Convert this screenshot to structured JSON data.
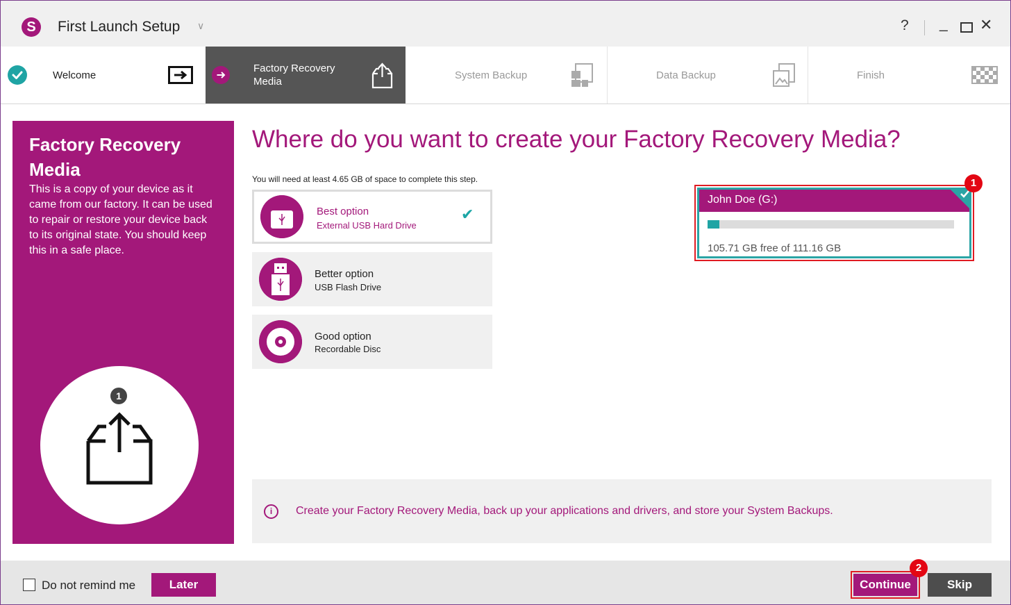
{
  "window": {
    "logo_letter": "S",
    "title": "First Launch Setup",
    "help_label": "?",
    "minimize_label": "_",
    "close_label": "✕"
  },
  "steps": [
    {
      "label": "Welcome",
      "state": "done",
      "icon": "arrow-box-icon"
    },
    {
      "label_line1": "Factory Recovery",
      "label_line2": "Media",
      "state": "active",
      "icon": "box-upload-icon"
    },
    {
      "label": "System Backup",
      "state": "pending",
      "icon": "windows-backup-icon"
    },
    {
      "label": "Data Backup",
      "state": "pending",
      "icon": "image-backup-icon"
    },
    {
      "label": "Finish",
      "state": "pending",
      "icon": "checkered-flag-icon"
    }
  ],
  "left_panel": {
    "title": "Factory Recovery Media",
    "description": "This is a copy of your device as it came from our factory. It can be used to repair or restore your device back to its original state. You should keep this in a safe place.",
    "step_number": "1"
  },
  "main": {
    "title": "Where do you want to create your Factory Recovery Media?",
    "space_note": "You will need at least 4.65 GB of space to complete this step.",
    "options": [
      {
        "name": "Best option",
        "desc": "External USB Hard Drive",
        "selected": true,
        "icon": "external-hdd-icon"
      },
      {
        "name": "Better option",
        "desc": "USB Flash Drive",
        "selected": false,
        "icon": "usb-flash-icon"
      },
      {
        "name": "Good option",
        "desc": "Recordable Disc",
        "selected": false,
        "icon": "disc-icon"
      }
    ],
    "drive": {
      "name": "John Doe (G:)",
      "free_text": "105.71 GB free of 111.16 GB",
      "used_fraction": 0.049
    },
    "info": {
      "icon_glyph": "i",
      "text": "Create your Factory Recovery Media, back up your applications and drivers, and store your System Backups."
    }
  },
  "annotations": {
    "badge1": "1",
    "badge2": "2"
  },
  "footer": {
    "remind_label": "Do not remind me",
    "later_label": "Later",
    "continue_label": "Continue",
    "skip_label": "Skip"
  },
  "colors": {
    "accent": "#a3187a",
    "teal": "#1fa4a4",
    "active_step": "#555555",
    "annotation_red": "#e30613"
  }
}
